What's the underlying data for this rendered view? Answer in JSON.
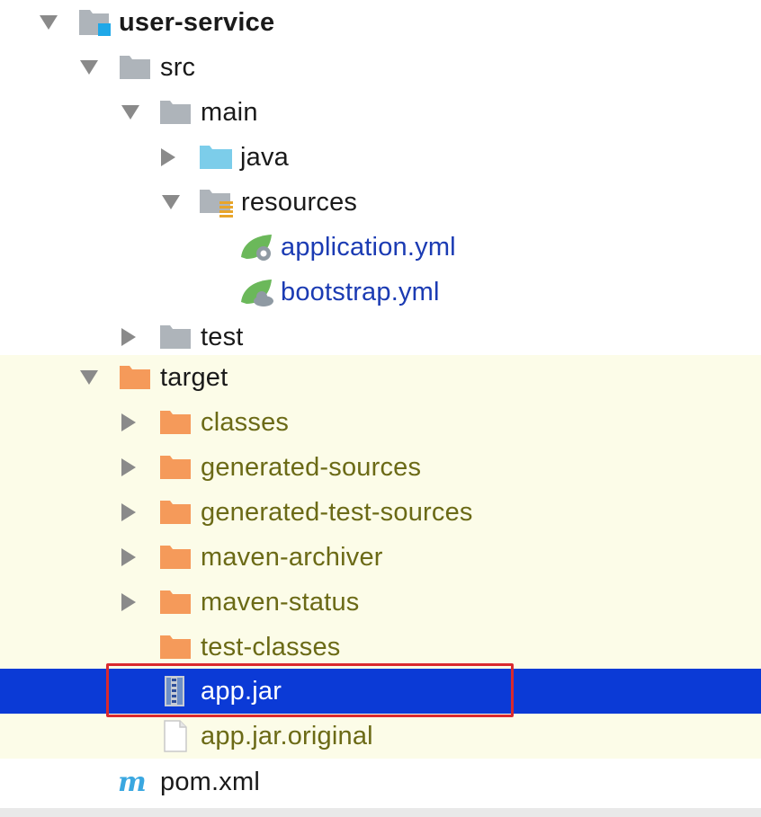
{
  "tree": {
    "root": {
      "label": "user-service"
    },
    "src": {
      "label": "src"
    },
    "main": {
      "label": "main"
    },
    "java": {
      "label": "java"
    },
    "resources": {
      "label": "resources"
    },
    "application_yml": {
      "label": "application.yml"
    },
    "bootstrap_yml": {
      "label": "bootstrap.yml"
    },
    "test": {
      "label": "test"
    },
    "target": {
      "label": "target"
    },
    "classes": {
      "label": "classes"
    },
    "generated_sources": {
      "label": "generated-sources"
    },
    "generated_test_sources": {
      "label": "generated-test-sources"
    },
    "maven_archiver": {
      "label": "maven-archiver"
    },
    "maven_status": {
      "label": "maven-status"
    },
    "test_classes": {
      "label": "test-classes"
    },
    "app_jar": {
      "label": "app.jar"
    },
    "app_jar_original": {
      "label": "app.jar.original"
    },
    "pom_xml": {
      "label": "pom.xml"
    }
  },
  "colors": {
    "selection": "#0b3ad6",
    "excluded_background": "#fcfce8",
    "highlight_border": "#d9292f",
    "folder_gray": "#aeb4ba",
    "folder_orange": "#f59a5a",
    "folder_source_blue": "#7ccdea",
    "spring_green": "#6bb85a",
    "maven_blue": "#3aa7e0"
  }
}
